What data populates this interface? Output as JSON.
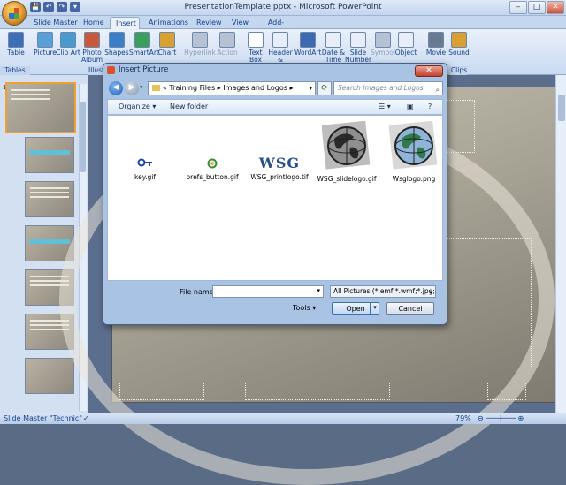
{
  "window": {
    "title": "PresentationTemplate.pptx - Microsoft PowerPoint",
    "controls": [
      "–",
      "□",
      "✕"
    ]
  },
  "quick_access": [
    "💾",
    "↶",
    "↷",
    "▾"
  ],
  "tabs": [
    {
      "label": "Slide Master",
      "active": false
    },
    {
      "label": "Home",
      "active": false
    },
    {
      "label": "Insert",
      "active": true
    },
    {
      "label": "Animations",
      "active": false
    },
    {
      "label": "Review",
      "active": false
    },
    {
      "label": "View",
      "active": false
    },
    {
      "label": "Add-Ins",
      "active": false
    }
  ],
  "ribbon": {
    "buttons": [
      {
        "label": "Table",
        "icon": "table-icon",
        "color": "#3f6fb8",
        "disabled": false
      },
      {
        "label": "Picture",
        "icon": "picture-icon",
        "color": "#5aa0d8",
        "disabled": false
      },
      {
        "label": "Clip Art",
        "icon": "clipart-icon",
        "color": "#4a9ad0",
        "disabled": false
      },
      {
        "label": "Photo Album",
        "icon": "photo-album-icon",
        "color": "#c85a3a",
        "disabled": false
      },
      {
        "label": "Shapes",
        "icon": "shapes-icon",
        "color": "#3a7fc8",
        "disabled": false
      },
      {
        "label": "SmartArt",
        "icon": "smartart-icon",
        "color": "#3aa05a",
        "disabled": false
      },
      {
        "label": "Chart",
        "icon": "chart-icon",
        "color": "#d8a030",
        "disabled": false
      },
      {
        "label": "Hyperlink",
        "icon": "hyperlink-icon",
        "color": "#b6c2d4",
        "disabled": true
      },
      {
        "label": "Action",
        "icon": "action-icon",
        "color": "#b6c2d4",
        "disabled": true
      },
      {
        "label": "Text Box",
        "icon": "textbox-icon",
        "color": "#ffffff",
        "disabled": false
      },
      {
        "label": "Header & Footer",
        "icon": "header-footer-icon",
        "color": "#e8eef8",
        "disabled": false
      },
      {
        "label": "WordArt",
        "icon": "wordart-icon",
        "color": "#3a6ab0",
        "disabled": false
      },
      {
        "label": "Date & Time",
        "icon": "date-time-icon",
        "color": "#e8eef8",
        "disabled": false
      },
      {
        "label": "Slide Number",
        "icon": "slide-number-icon",
        "color": "#e8eef8",
        "disabled": false
      },
      {
        "label": "Symbol",
        "icon": "symbol-icon",
        "color": "#b6c2d4",
        "disabled": true
      },
      {
        "label": "Object",
        "icon": "object-icon",
        "color": "#e8eef8",
        "disabled": false
      },
      {
        "label": "Movie",
        "icon": "movie-icon",
        "color": "#6a7a90",
        "disabled": false
      },
      {
        "label": "Sound",
        "icon": "sound-icon",
        "color": "#d8a030",
        "disabled": false
      }
    ],
    "groups": [
      "Tables",
      "Illustrations",
      "Clips"
    ]
  },
  "dialog": {
    "title": "Insert Picture",
    "close": "✕",
    "path_prefix": "«",
    "path": [
      "Training Files",
      "Images and Logos"
    ],
    "path_separator": "▸",
    "search_placeholder": "Search Images and Logos",
    "organize": "Organize ▾",
    "new_folder": "New folder",
    "files": [
      {
        "name": "key.gif",
        "icon": "key-icon"
      },
      {
        "name": "prefs_button.gif",
        "icon": "prefs-button-icon"
      },
      {
        "name": "WSG_printlogo.tif",
        "icon": "wsg-logo-icon",
        "logo_text": "WSG"
      },
      {
        "name": "WSG_slidelogo.gif",
        "icon": "globe-icon"
      },
      {
        "name": "Wsglogo.png",
        "icon": "globe-color-icon"
      }
    ],
    "file_name_label": "File name:",
    "file_name_value": "",
    "file_type": "All Pictures (*.emf;*.wmf;*.jpg;",
    "tools": "Tools ▾",
    "open": "Open",
    "cancel": "Cancel"
  },
  "status": {
    "view": "Slide Master",
    "theme": "\"Technic\"",
    "zoom": "79%"
  },
  "colors": {
    "accent": "#15428b",
    "selected_thumb": "#f0a030",
    "ribbon": "#c9daf1"
  }
}
